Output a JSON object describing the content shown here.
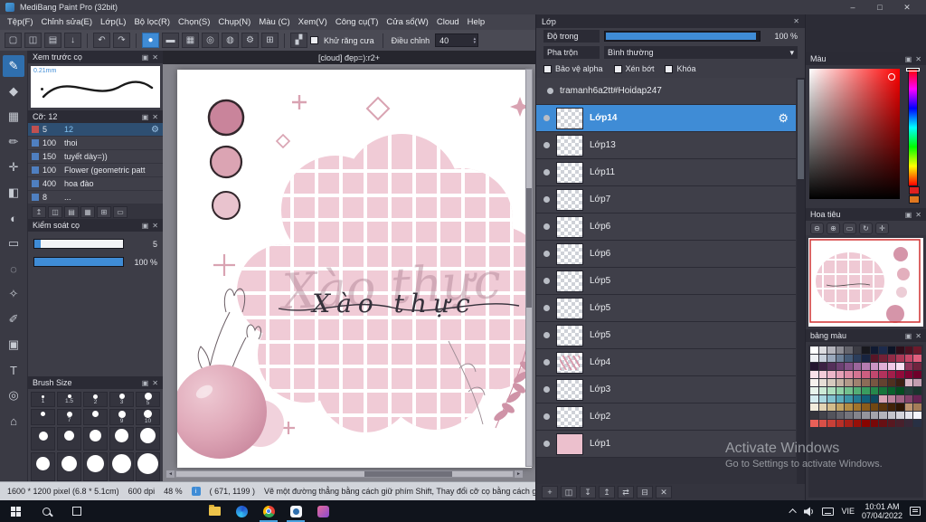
{
  "titlebar": {
    "title": "MediBang Paint Pro (32bit)"
  },
  "icons": {
    "close": "✕",
    "panel": "▣",
    "gear": "⚙",
    "dropdown": "▾",
    "spin_up": "▴",
    "spin_down": "▾",
    "left": "◄",
    "right": "►",
    "min": "–",
    "max": "□",
    "undo": "↶",
    "redo": "↷",
    "antialias": "▞",
    "info": "i"
  },
  "menubar": {
    "items": [
      "Tệp(F)",
      "Chỉnh sửa(E)",
      "Lớp(L)",
      "Bộ lọc(R)",
      "Chọn(S)",
      "Chụp(N)",
      "Màu (C)",
      "Xem(V)",
      "Công cụ(T)",
      "Cửa sổ(W)",
      "Cloud",
      "Help"
    ]
  },
  "toolbar": {
    "file_glyphs": [
      "▢",
      "◫",
      "▤",
      "↓"
    ],
    "brush_glyphs": [
      "●",
      "▬",
      "▦",
      "◎",
      "◍",
      "⚙",
      "⊞"
    ],
    "antialias": "Khử răng cưa",
    "adjust": "Điều chỉnh",
    "adjust_value": "40"
  },
  "tools": {
    "glyphs": [
      "✎",
      "◆",
      "▦",
      "✏",
      "✛",
      "◧",
      "◐",
      "▭",
      "◌",
      "✧",
      "✐",
      "▣",
      "T",
      "◎",
      "⌂"
    ]
  },
  "brush_preview": {
    "title": "Xem trước cọ",
    "size": "0.21mm"
  },
  "brush_list": {
    "title": "Cỡ: 12",
    "minibar": [
      "↥",
      "◫",
      "▤",
      "▦",
      "⊞",
      "▭"
    ],
    "items": [
      {
        "size": "5",
        "name": "12",
        "color": "#c05050"
      },
      {
        "size": "100",
        "name": "thoi",
        "color": "#4f7fc0"
      },
      {
        "size": "150",
        "name": "tuyết dày=))",
        "color": "#4f7fc0"
      },
      {
        "size": "100",
        "name": "Flower (geometric patt",
        "color": "#4f7fc0"
      },
      {
        "size": "400",
        "name": "hoa đào",
        "color": "#4f7fc0"
      },
      {
        "size": "8",
        "name": "...",
        "color": "#4f7fc0"
      }
    ]
  },
  "brush_control": {
    "title": "Kiểm soát cọ",
    "values": [
      "5",
      "100 %"
    ]
  },
  "brush_size": {
    "title": "Brush Size",
    "cells": [
      {
        "l": "1",
        "d": 3
      },
      {
        "l": "1.5",
        "d": 4
      },
      {
        "l": "2",
        "d": 5
      },
      {
        "l": "3",
        "d": 6
      },
      {
        "l": "5",
        "d": 8
      },
      {
        "l": "",
        "d": 5
      },
      {
        "l": "7",
        "d": 6
      },
      {
        "l": "",
        "d": 7
      },
      {
        "l": "9",
        "d": 8
      },
      {
        "l": "10",
        "d": 9
      },
      {
        "l": "",
        "d": 10
      },
      {
        "l": "",
        "d": 11
      },
      {
        "l": "",
        "d": 13
      },
      {
        "l": "",
        "d": 15
      },
      {
        "l": "",
        "d": 17
      },
      {
        "l": "",
        "d": 15
      },
      {
        "l": "",
        "d": 17
      },
      {
        "l": "",
        "d": 19
      },
      {
        "l": "",
        "d": 21
      },
      {
        "l": "",
        "d": 23
      }
    ]
  },
  "canvas": {
    "tab": "[cloud] đẹp=):r2+",
    "script_text": "Xào thực",
    "ghost_text": "Xào thực"
  },
  "layer_panel": {
    "title": "Lớp",
    "opacity_label": "Độ trong",
    "opacity_value": "100 %",
    "blend_label": "Pha trộn",
    "blend_value": "Bình thường",
    "check_alpha": "Bảo vệ alpha",
    "check_clip": "Xén bớt",
    "check_lock": "Khóa",
    "bottom_glyphs": [
      "+",
      "◫",
      "↧",
      "↥",
      "⇄",
      "⊟",
      "✕"
    ],
    "layers": [
      {
        "name": "tramanh6a2tt#Hoidap247"
      },
      {
        "name": "Lớp14"
      },
      {
        "name": "Lớp13"
      },
      {
        "name": "Lớp11"
      },
      {
        "name": "Lớp7"
      },
      {
        "name": "Lớp6"
      },
      {
        "name": "Lớp6"
      },
      {
        "name": "Lớp5"
      },
      {
        "name": "Lớp5"
      },
      {
        "name": "Lớp5"
      },
      {
        "name": "Lớp4"
      },
      {
        "name": "Lớp3"
      },
      {
        "name": "Lớp2"
      },
      {
        "name": "Lớp1"
      }
    ]
  },
  "color_panel": {
    "title": "Màu",
    "current": "#e02020",
    "secondary": "#e07820"
  },
  "navigator": {
    "title": "Hoa tiêu",
    "icon_glyphs": [
      "⊖",
      "⊕",
      "▭",
      "↻",
      "✛"
    ]
  },
  "palette": {
    "title": "bảng màu",
    "colors": [
      "#ffffff",
      "#dcdce0",
      "#b4b4bc",
      "#8c8c94",
      "#64646c",
      "#3c3c44",
      "#18181e",
      "#101a32",
      "#1c2a4c",
      "#0c1426",
      "#2e0e1a",
      "#4e1222",
      "#6e1a2c",
      "#eef0f4",
      "#c8d0dc",
      "#9aa8bc",
      "#6c8098",
      "#465c78",
      "#2c3e5c",
      "#182440",
      "#581628",
      "#742036",
      "#902a46",
      "#ac3856",
      "#c84868",
      "#e0607e",
      "#241630",
      "#3c2244",
      "#54305a",
      "#6c4072",
      "#845288",
      "#9c669c",
      "#b47cb0",
      "#cc94c4",
      "#e0aed6",
      "#f0c8e6",
      "#f8e0f2",
      "#90345a",
      "#70243e",
      "#f8e2ea",
      "#f2ccd8",
      "#ecb6c8",
      "#e4a0b6",
      "#dc8aa4",
      "#d47492",
      "#cc5e80",
      "#c0486e",
      "#b2325c",
      "#a21e4a",
      "#920a3a",
      "#800232",
      "#6e002a",
      "#f6f2ee",
      "#e6ded6",
      "#d6cabe",
      "#c4b2a4",
      "#b29a8a",
      "#a08270",
      "#8c6c58",
      "#785642",
      "#644230",
      "#503020",
      "#3c2014",
      "#dab8c6",
      "#c29eb0",
      "#e8f4ec",
      "#ccead6",
      "#aedebe",
      "#90d0a6",
      "#72c08e",
      "#54ae76",
      "#3a9c60",
      "#26884c",
      "#16743a",
      "#0a602c",
      "#044c20",
      "#24403a",
      "#1a342e",
      "#d4ecf0",
      "#aad8e0",
      "#82c2ce",
      "#5cacbc",
      "#3c94a8",
      "#247a92",
      "#12607a",
      "#0e4a60",
      "#d8a4b4",
      "#bc849c",
      "#a06484",
      "#84446c",
      "#682454",
      "#f2ecdc",
      "#e2d4b4",
      "#d2bc8c",
      "#c2a464",
      "#b28c44",
      "#a2742c",
      "#8a5c1c",
      "#724812",
      "#5a340c",
      "#422208",
      "#2e1604",
      "#bc9470",
      "#a47c58",
      "#34343c",
      "#44444c",
      "#54545c",
      "#64646c",
      "#74747c",
      "#84848c",
      "#94949c",
      "#a4a4ac",
      "#b4b4bc",
      "#c4c4cc",
      "#d4d4dc",
      "#e4e4ec",
      "#f4f4fc",
      "#e86058",
      "#d85048",
      "#c84038",
      "#b83028",
      "#a82018",
      "#981008",
      "#880400",
      "#780808",
      "#681014",
      "#581820",
      "#48202c",
      "#382838",
      "#283044"
    ]
  },
  "statusbar": {
    "dimensions": "1600 * 1200 pixel  (6.8 * 5.1cm)",
    "dpi": "600 dpi",
    "zoom": "48 %",
    "coords": "( 671, 1199 )",
    "hint": "Vẽ một đường thẳng bằng cách giữ phím Shift, Thay đổi cỡ cọ bằng cách giữ phím Ctr"
  },
  "watermark": {
    "line1": "Activate Windows",
    "line2": "Go to Settings to activate Windows."
  },
  "taskbar": {
    "language": "VIE",
    "time": "10:01 AM",
    "date": "07/04/2022"
  }
}
